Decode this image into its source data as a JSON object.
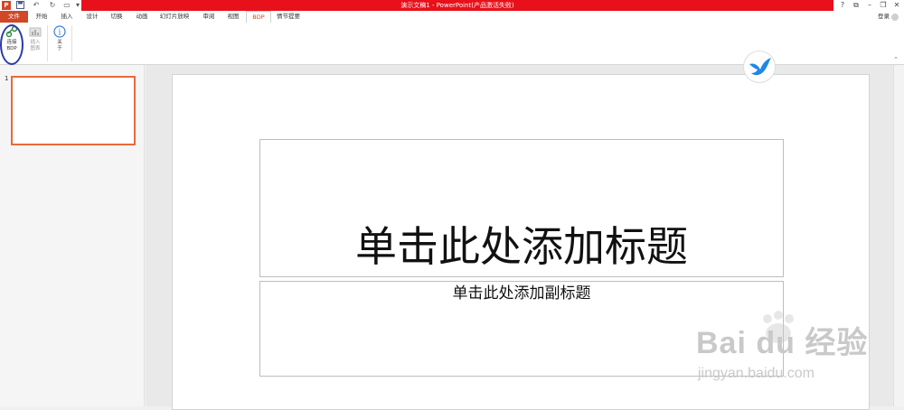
{
  "window": {
    "title": "演示文稿1 - PowerPoint(产品激活失败)",
    "help": "?",
    "controls": [
      "restore",
      "minimize",
      "maximize",
      "close"
    ]
  },
  "qat": {
    "app_icon": "P",
    "save_icon": "save-icon",
    "undo_icon": "undo-icon",
    "redo_icon": "redo-icon",
    "present_icon": "present-icon"
  },
  "tabs": {
    "file": "文件",
    "items": [
      "开始",
      "插入",
      "设计",
      "切换",
      "动画",
      "幻灯片放映",
      "审阅",
      "视图",
      "BDP",
      "情节提要"
    ],
    "active": "BDP",
    "login": "登录"
  },
  "ribbon": {
    "connect_bdp": "连接BDP",
    "connect_bdp_l1": "连接",
    "connect_bdp_l2": "BDP",
    "insert_chart_l1": "插入",
    "insert_chart_l2": "图表",
    "about_l1": "关",
    "about_l2": "于"
  },
  "thumbnails": {
    "slide_number": "1"
  },
  "slide": {
    "title_placeholder": "单击此处添加标题",
    "subtitle_placeholder": "单击此处添加副标题"
  },
  "watermark": {
    "brand": "Bai du 经验",
    "url": "jingyan.baidu.com"
  },
  "colors": {
    "title_bar": "#e8101a",
    "file_tab": "#d24726",
    "active_tab_text": "#d24726",
    "thumbnail_border": "#e86a3a",
    "annotation_circle": "#2a3aa8"
  }
}
